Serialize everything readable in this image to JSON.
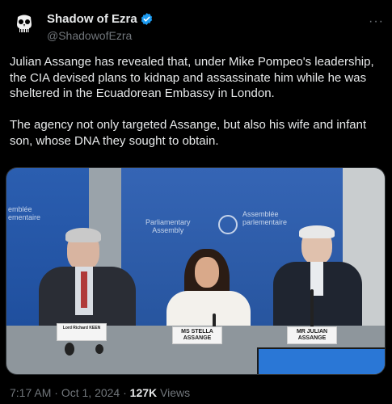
{
  "author": {
    "display_name": "Shadow of Ezra",
    "handle": "@ShadowofEzra",
    "avatar_icon": "skull-icon",
    "verified_icon": "verified-badge-icon",
    "verified_color": "#1d9bf0"
  },
  "more_label": "···",
  "tweet": {
    "paragraph_1": "Julian Assange has revealed that, under Mike Pompeo's leadership, the CIA devised plans to kidnap and assassinate him while he was sheltered in the Ecuadorean Embassy in London.",
    "paragraph_2": "The agency not only targeted Assange, but also his wife and infant son, whose DNA they sought to obtain."
  },
  "media": {
    "backdrop_left_text": "emblée\nementaire",
    "backdrop_center_text": "Parliamentary\nAssembly",
    "backdrop_right_text": "Assemblée\nparlementaire",
    "nameplates": [
      "Lord Richard KEEN",
      "MS STELLA\nASSANGE",
      "MR JULIAN\nASSANGE"
    ]
  },
  "meta": {
    "time": "7:17 AM",
    "separator": "·",
    "date": "Oct 1, 2024",
    "views_count": "127K",
    "views_label": "Views"
  },
  "colors": {
    "background": "#000000",
    "text_primary": "#e7e9ea",
    "text_secondary": "#71767b"
  }
}
